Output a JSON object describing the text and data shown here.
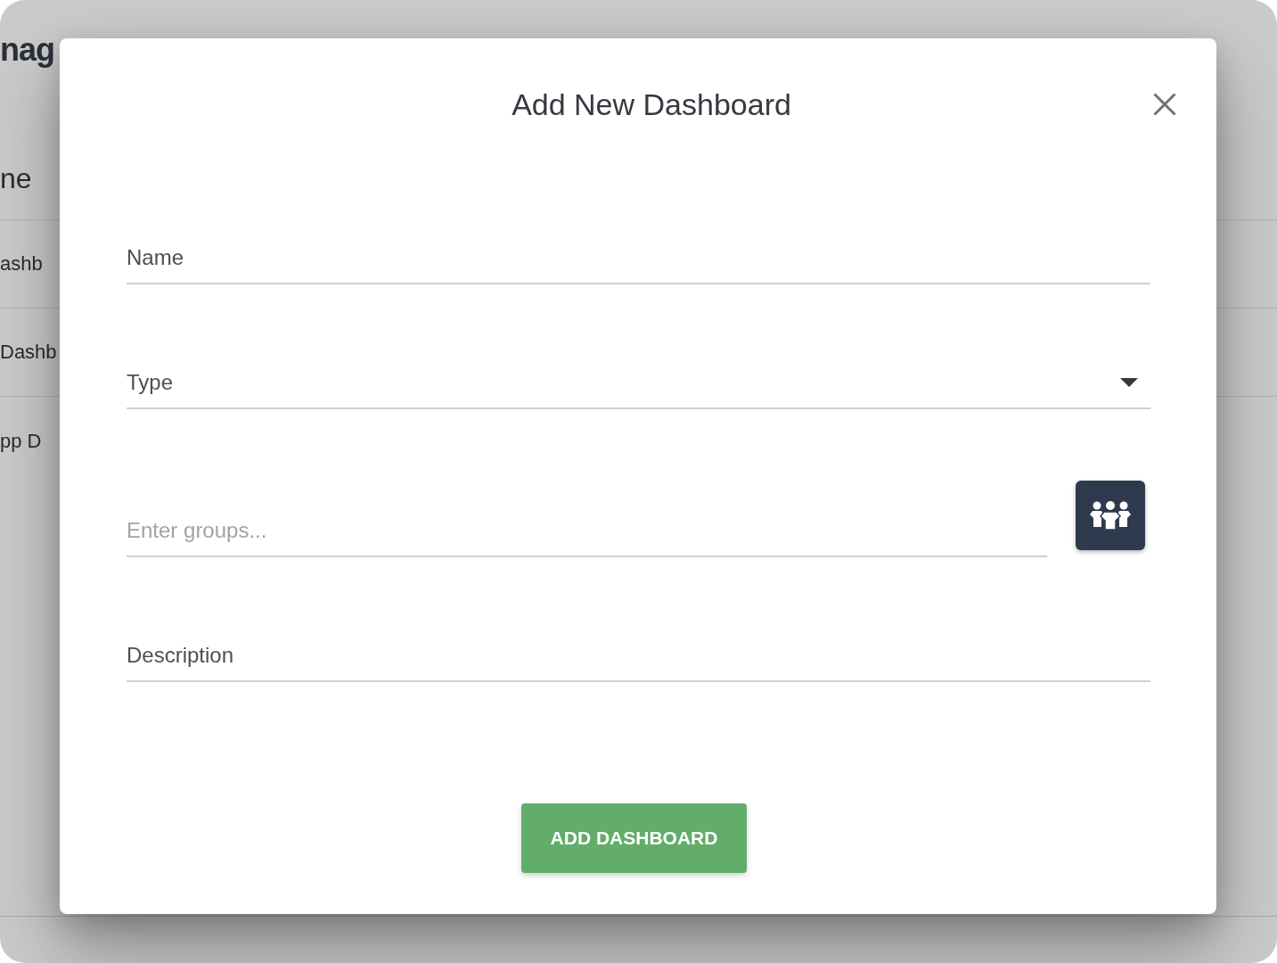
{
  "background_page": {
    "title": "nag",
    "table": {
      "header": "ne",
      "rows": [
        "ashb",
        "Dashb",
        "pp D"
      ]
    }
  },
  "dialog": {
    "title": "Add New Dashboard",
    "fields": [
      {
        "kind": "text",
        "label": "Name"
      },
      {
        "kind": "select",
        "label": "Type"
      },
      {
        "kind": "groups",
        "placeholder": "Enter groups..."
      },
      {
        "kind": "text",
        "label": "Description"
      }
    ],
    "submit_button": "ADD DASHBOARD"
  }
}
